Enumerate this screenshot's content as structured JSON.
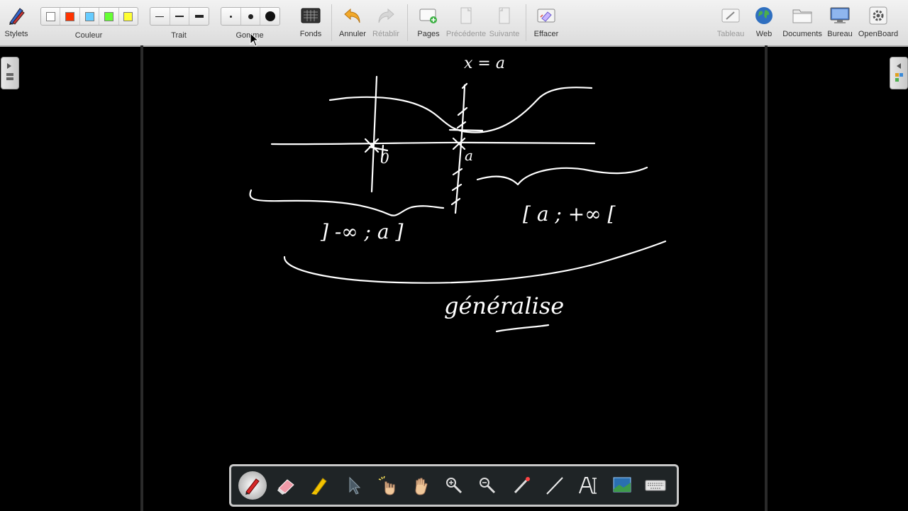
{
  "toolbar": {
    "pens_label": "Stylets",
    "color_label": "Couleur",
    "line_label": "Trait",
    "eraser_label": "Gomme",
    "background_label": "Fonds",
    "undo_label": "Annuler",
    "redo_label": "Rétablir",
    "pages_label": "Pages",
    "previous_label": "Précédente",
    "next_label": "Suivante",
    "clear_label": "Effacer",
    "board_label": "Tableau",
    "web_label": "Web",
    "documents_label": "Documents",
    "desktop_label": "Bureau",
    "openboard_label": "OpenBoard",
    "colors": [
      "#ffffff",
      "#ff3300",
      "#66ccff",
      "#66ff33",
      "#ffff33"
    ]
  },
  "board": {
    "labels": {
      "vline": "x = a",
      "origin": "0",
      "a_mark": "a",
      "left_interval": "] -∞ ; a ]",
      "right_interval": "[ a ; +∞ [",
      "general": "généralise"
    }
  },
  "dock": {
    "tools": [
      "pen",
      "eraser",
      "marker",
      "selector",
      "play",
      "hand",
      "zoom-in",
      "zoom-out",
      "pointer",
      "line",
      "text",
      "capture",
      "keyboard"
    ]
  }
}
